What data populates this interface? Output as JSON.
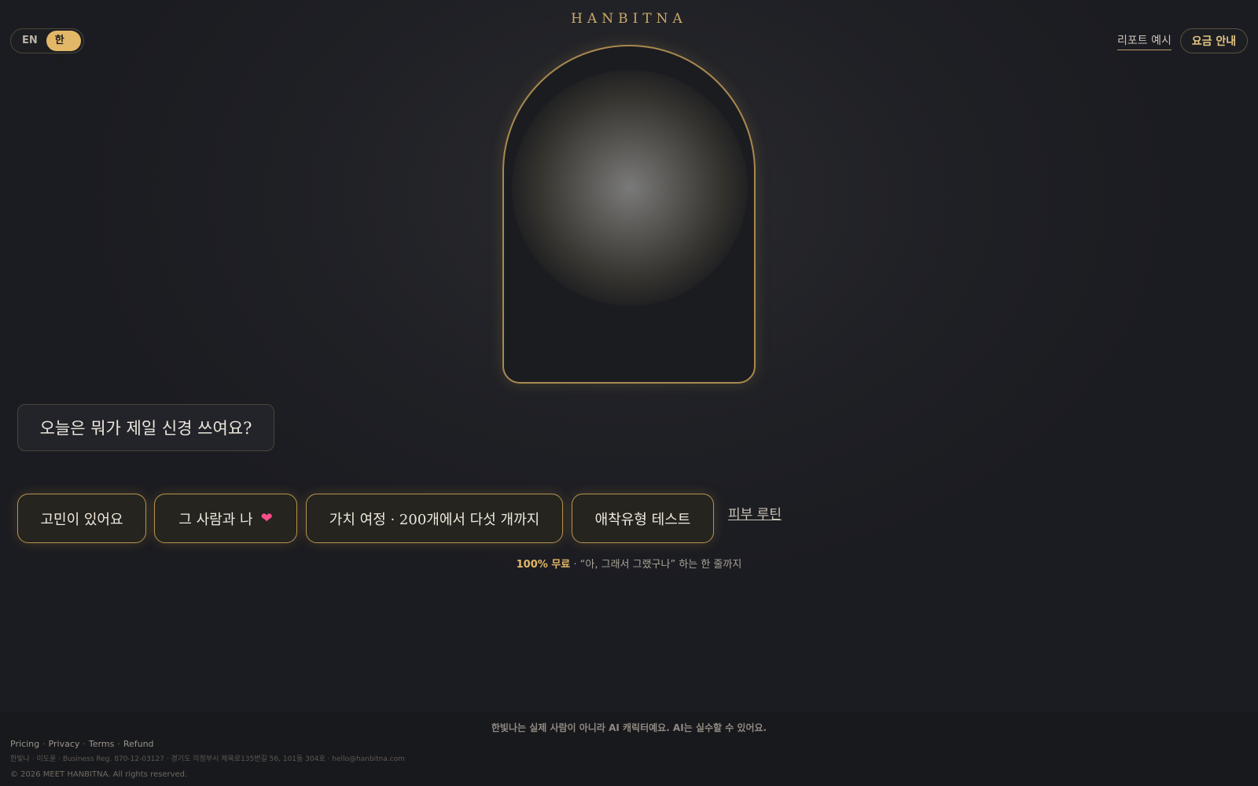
{
  "header": {
    "lang": {
      "en": "EN",
      "ko": "한글",
      "active": "ko"
    },
    "brand": "HANBITNA",
    "report_link": "리포트 예시",
    "pricing_button": "요금 안내"
  },
  "chat": {
    "question": "오늘은 뭐가 제일 신경 쓰여요?"
  },
  "options": {
    "items": [
      {
        "label": "고민이 있어요"
      },
      {
        "label": "그 사람과 나",
        "icon": "heart-icon"
      },
      {
        "label": "가치 여정 · 200개에서 다섯 개까지"
      },
      {
        "label": "애착유형 테스트"
      }
    ],
    "extra_link": "피부 루틴"
  },
  "tagline": {
    "free": "100% 무료",
    "rest": " · “아, 그래서 그랬구나” 하는 한 줄까지"
  },
  "footer": {
    "disclaimer": "한빛나는 실제 사람이 아니라 AI 캐릭터예요. AI는 실수할 수 있어요.",
    "links": [
      "Pricing",
      "Privacy",
      "Terms",
      "Refund"
    ],
    "business": "한빛나 · 이도윤 · Business Reg. 870-12-03127 · 경기도 의정부시 체육로135번길 56, 101동 304호 · hello@hanbitna.com",
    "copyright": "© 2026 MEET HANBITNA. All rights reserved."
  },
  "colors": {
    "accent": "#e3b768",
    "border_gold": "#b8924f",
    "background": "#1c1d22"
  }
}
